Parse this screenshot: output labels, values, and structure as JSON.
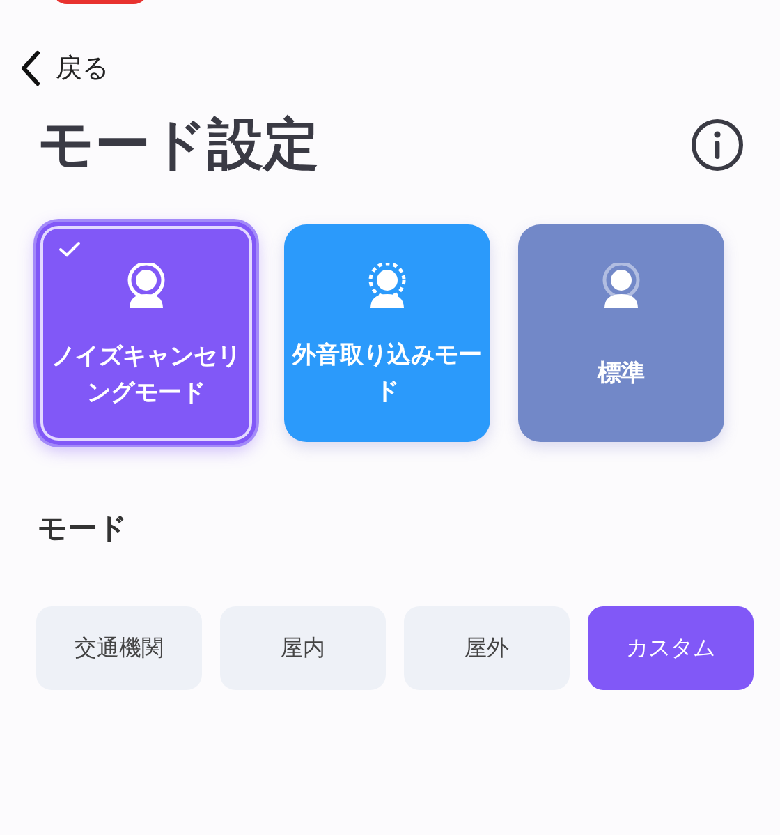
{
  "back": {
    "label": "戻る"
  },
  "title": "モード設定",
  "cards": [
    {
      "label": "ノイズキャンセリングモード",
      "kind": "ring",
      "color": "#8158f7",
      "selected": true
    },
    {
      "label": "外音取り込みモード",
      "kind": "dashed",
      "color": "#2b9afb",
      "selected": false
    },
    {
      "label": "標準",
      "kind": "faint",
      "color": "#7288c8",
      "selected": false
    }
  ],
  "section_title": "モード",
  "chips": [
    {
      "label": "交通機関",
      "selected": false
    },
    {
      "label": "屋内",
      "selected": false
    },
    {
      "label": "屋外",
      "selected": false
    },
    {
      "label": "カスタム",
      "selected": true
    }
  ]
}
